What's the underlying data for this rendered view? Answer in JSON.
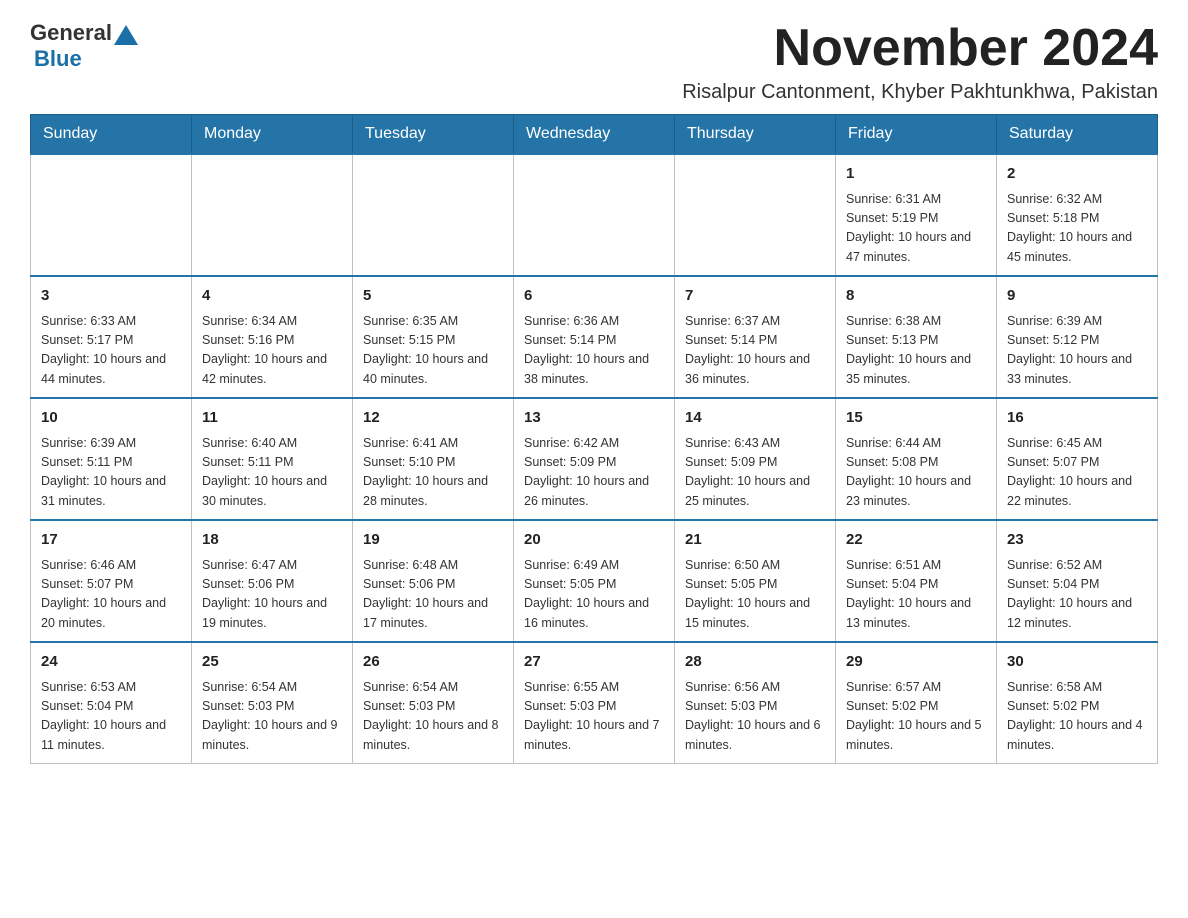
{
  "logo": {
    "general": "General",
    "blue": "Blue"
  },
  "header": {
    "month_year": "November 2024",
    "location": "Risalpur Cantonment, Khyber Pakhtunkhwa, Pakistan"
  },
  "days_of_week": [
    "Sunday",
    "Monday",
    "Tuesday",
    "Wednesday",
    "Thursday",
    "Friday",
    "Saturday"
  ],
  "weeks": [
    {
      "days": [
        {
          "number": "",
          "info": ""
        },
        {
          "number": "",
          "info": ""
        },
        {
          "number": "",
          "info": ""
        },
        {
          "number": "",
          "info": ""
        },
        {
          "number": "",
          "info": ""
        },
        {
          "number": "1",
          "info": "Sunrise: 6:31 AM\nSunset: 5:19 PM\nDaylight: 10 hours and 47 minutes."
        },
        {
          "number": "2",
          "info": "Sunrise: 6:32 AM\nSunset: 5:18 PM\nDaylight: 10 hours and 45 minutes."
        }
      ]
    },
    {
      "days": [
        {
          "number": "3",
          "info": "Sunrise: 6:33 AM\nSunset: 5:17 PM\nDaylight: 10 hours and 44 minutes."
        },
        {
          "number": "4",
          "info": "Sunrise: 6:34 AM\nSunset: 5:16 PM\nDaylight: 10 hours and 42 minutes."
        },
        {
          "number": "5",
          "info": "Sunrise: 6:35 AM\nSunset: 5:15 PM\nDaylight: 10 hours and 40 minutes."
        },
        {
          "number": "6",
          "info": "Sunrise: 6:36 AM\nSunset: 5:14 PM\nDaylight: 10 hours and 38 minutes."
        },
        {
          "number": "7",
          "info": "Sunrise: 6:37 AM\nSunset: 5:14 PM\nDaylight: 10 hours and 36 minutes."
        },
        {
          "number": "8",
          "info": "Sunrise: 6:38 AM\nSunset: 5:13 PM\nDaylight: 10 hours and 35 minutes."
        },
        {
          "number": "9",
          "info": "Sunrise: 6:39 AM\nSunset: 5:12 PM\nDaylight: 10 hours and 33 minutes."
        }
      ]
    },
    {
      "days": [
        {
          "number": "10",
          "info": "Sunrise: 6:39 AM\nSunset: 5:11 PM\nDaylight: 10 hours and 31 minutes."
        },
        {
          "number": "11",
          "info": "Sunrise: 6:40 AM\nSunset: 5:11 PM\nDaylight: 10 hours and 30 minutes."
        },
        {
          "number": "12",
          "info": "Sunrise: 6:41 AM\nSunset: 5:10 PM\nDaylight: 10 hours and 28 minutes."
        },
        {
          "number": "13",
          "info": "Sunrise: 6:42 AM\nSunset: 5:09 PM\nDaylight: 10 hours and 26 minutes."
        },
        {
          "number": "14",
          "info": "Sunrise: 6:43 AM\nSunset: 5:09 PM\nDaylight: 10 hours and 25 minutes."
        },
        {
          "number": "15",
          "info": "Sunrise: 6:44 AM\nSunset: 5:08 PM\nDaylight: 10 hours and 23 minutes."
        },
        {
          "number": "16",
          "info": "Sunrise: 6:45 AM\nSunset: 5:07 PM\nDaylight: 10 hours and 22 minutes."
        }
      ]
    },
    {
      "days": [
        {
          "number": "17",
          "info": "Sunrise: 6:46 AM\nSunset: 5:07 PM\nDaylight: 10 hours and 20 minutes."
        },
        {
          "number": "18",
          "info": "Sunrise: 6:47 AM\nSunset: 5:06 PM\nDaylight: 10 hours and 19 minutes."
        },
        {
          "number": "19",
          "info": "Sunrise: 6:48 AM\nSunset: 5:06 PM\nDaylight: 10 hours and 17 minutes."
        },
        {
          "number": "20",
          "info": "Sunrise: 6:49 AM\nSunset: 5:05 PM\nDaylight: 10 hours and 16 minutes."
        },
        {
          "number": "21",
          "info": "Sunrise: 6:50 AM\nSunset: 5:05 PM\nDaylight: 10 hours and 15 minutes."
        },
        {
          "number": "22",
          "info": "Sunrise: 6:51 AM\nSunset: 5:04 PM\nDaylight: 10 hours and 13 minutes."
        },
        {
          "number": "23",
          "info": "Sunrise: 6:52 AM\nSunset: 5:04 PM\nDaylight: 10 hours and 12 minutes."
        }
      ]
    },
    {
      "days": [
        {
          "number": "24",
          "info": "Sunrise: 6:53 AM\nSunset: 5:04 PM\nDaylight: 10 hours and 11 minutes."
        },
        {
          "number": "25",
          "info": "Sunrise: 6:54 AM\nSunset: 5:03 PM\nDaylight: 10 hours and 9 minutes."
        },
        {
          "number": "26",
          "info": "Sunrise: 6:54 AM\nSunset: 5:03 PM\nDaylight: 10 hours and 8 minutes."
        },
        {
          "number": "27",
          "info": "Sunrise: 6:55 AM\nSunset: 5:03 PM\nDaylight: 10 hours and 7 minutes."
        },
        {
          "number": "28",
          "info": "Sunrise: 6:56 AM\nSunset: 5:03 PM\nDaylight: 10 hours and 6 minutes."
        },
        {
          "number": "29",
          "info": "Sunrise: 6:57 AM\nSunset: 5:02 PM\nDaylight: 10 hours and 5 minutes."
        },
        {
          "number": "30",
          "info": "Sunrise: 6:58 AM\nSunset: 5:02 PM\nDaylight: 10 hours and 4 minutes."
        }
      ]
    }
  ]
}
